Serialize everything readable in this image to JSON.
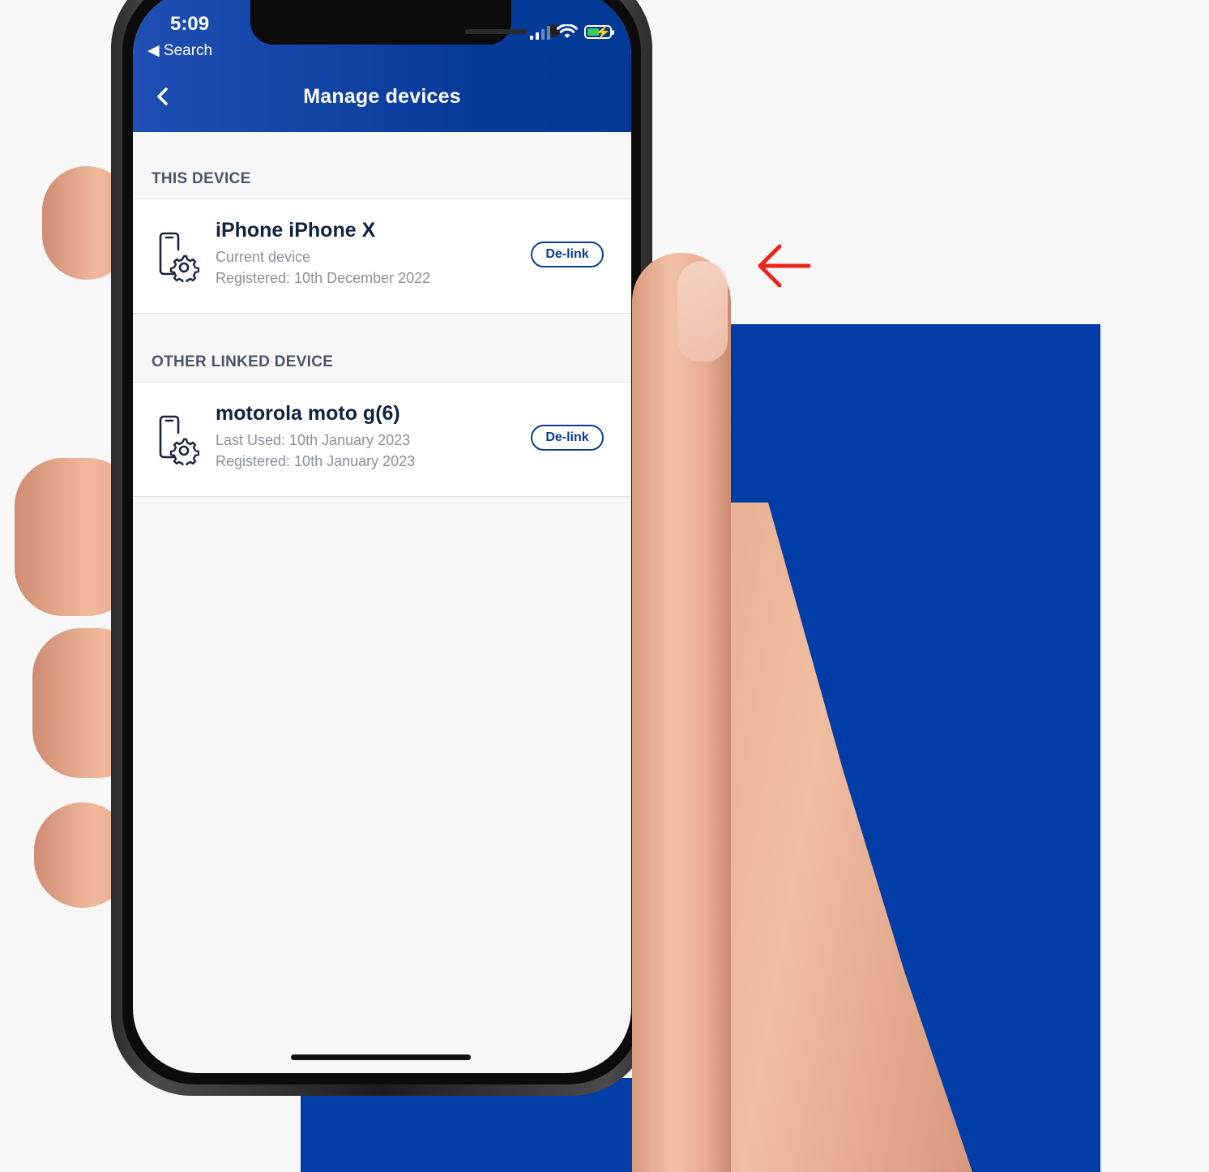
{
  "status_bar": {
    "time": "5:09",
    "back_app": "◀ Search"
  },
  "nav": {
    "title": "Manage devices",
    "back_icon": "chevron-left-icon"
  },
  "sections": [
    {
      "label": "THIS DEVICE",
      "device": {
        "name": "iPhone iPhone X",
        "line1": "Current device",
        "line2": "Registered: 10th December 2022",
        "action": "De-link",
        "icon": "phone-settings-icon"
      }
    },
    {
      "label": "OTHER LINKED DEVICE",
      "device": {
        "name": "motorola moto g(6)",
        "line1": "Last Used: 10th January 2023",
        "line2": "Registered: 10th January 2023",
        "action": "De-link",
        "icon": "phone-settings-icon"
      }
    }
  ],
  "colors": {
    "brand_blue": "#003da6",
    "header_blue": "#0a3f9e",
    "arrow_red": "#e8261f",
    "battery_green": "#3ecb5a"
  }
}
